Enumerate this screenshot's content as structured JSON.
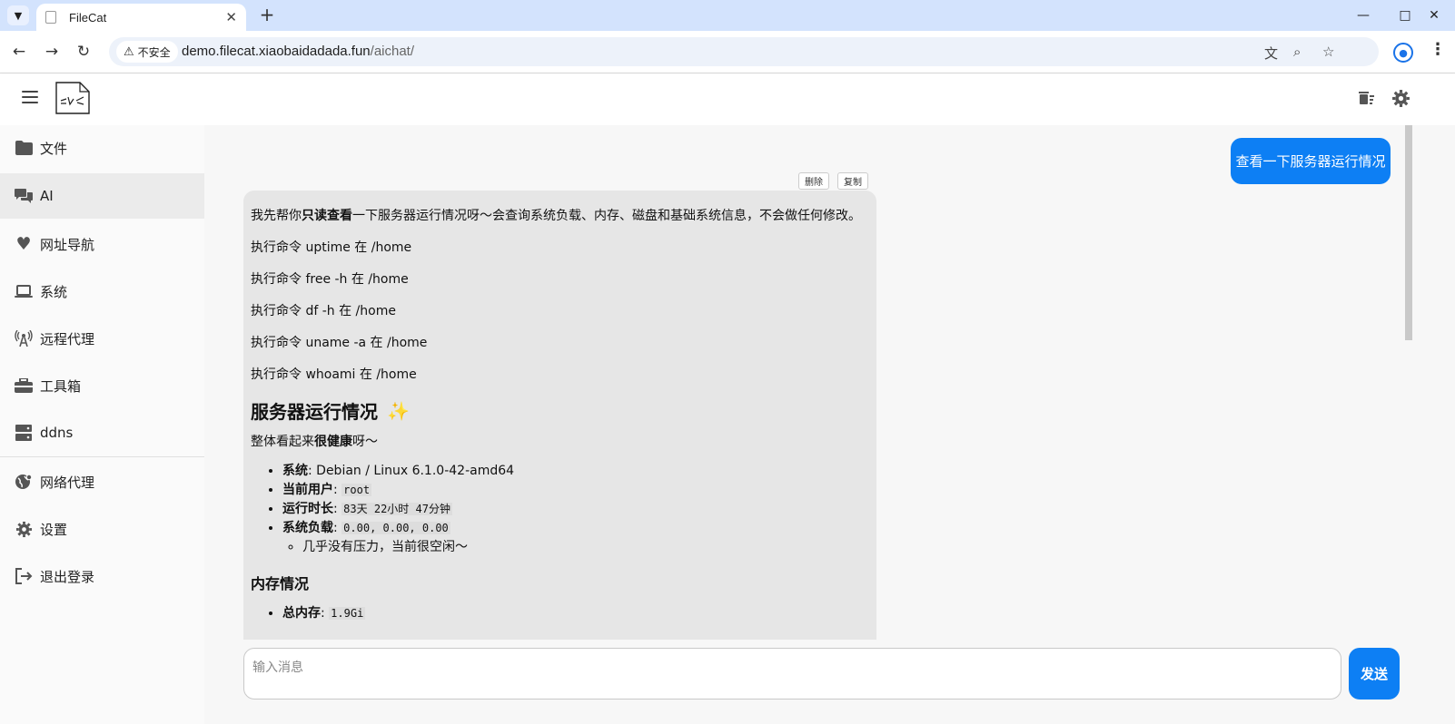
{
  "browser": {
    "tab_title": "FileCat",
    "security_label": "不安全",
    "url_host": "demo.filecat.xiaobaidadada.fun",
    "url_path": "/aichat/"
  },
  "sidebar": {
    "items": [
      {
        "label": "文件",
        "icon": "folder-icon"
      },
      {
        "label": "AI",
        "icon": "chat-icon"
      },
      {
        "label": "网址导航",
        "icon": "heart-icon"
      },
      {
        "label": "系统",
        "icon": "laptop-icon"
      },
      {
        "label": "远程代理",
        "icon": "antenna-icon"
      },
      {
        "label": "工具箱",
        "icon": "toolbox-icon"
      },
      {
        "label": "ddns",
        "icon": "server-icon"
      },
      {
        "label": "网络代理",
        "icon": "globe-icon"
      },
      {
        "label": "设置",
        "icon": "gear-icon"
      },
      {
        "label": "退出登录",
        "icon": "logout-icon"
      }
    ]
  },
  "chat": {
    "user_message": "查看一下服务器运行情况",
    "delete_label": "删除",
    "copy_label": "复制",
    "bot": {
      "intro_prefix": "我先帮你",
      "intro_bold": "只读查看",
      "intro_suffix": "一下服务器运行情况呀～会查询系统负载、内存、磁盘和基础系统信息，不会做任何修改。",
      "commands": [
        "执行命令 uptime 在 /home",
        "执行命令 free -h 在 /home",
        "执行命令 df -h 在 /home",
        "执行命令 uname -a 在 /home",
        "执行命令 whoami 在 /home"
      ],
      "heading": "服务器运行情况",
      "summary_prefix": "整体看起来",
      "summary_bold": "很健康",
      "summary_suffix": "呀～",
      "facts": [
        {
          "key": "系统",
          "value": ": Debian / Linux 6.1.0-42-amd64"
        },
        {
          "key": "当前用户",
          "value": "root"
        },
        {
          "key": "运行时长",
          "value": "83天 22小时 47分钟"
        },
        {
          "key": "系统负载",
          "value": "0.00, 0.00, 0.00"
        }
      ],
      "load_note": "几乎没有压力，当前很空闲～",
      "memory_heading": "内存情况",
      "memory_key": "总内存",
      "memory_value": "1.9Gi"
    }
  },
  "input": {
    "placeholder": "输入消息",
    "send_label": "发送"
  }
}
